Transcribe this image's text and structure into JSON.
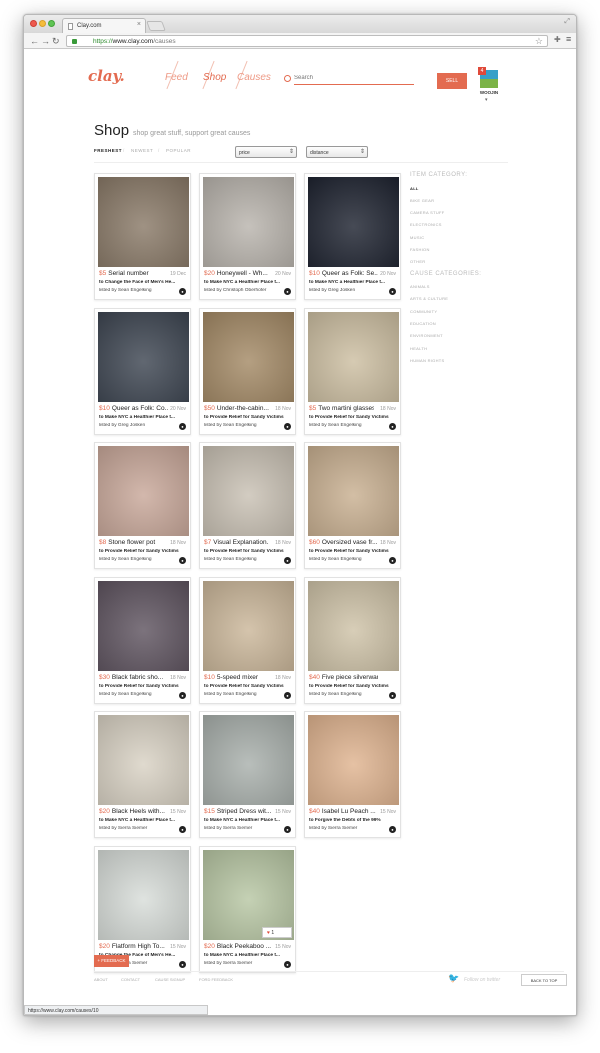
{
  "browser": {
    "tab_title": "Clay.com",
    "url_scheme": "https://",
    "url_host": "www.clay.com",
    "url_path": "/causes",
    "status_url": "https://www.clay.com/causes/10"
  },
  "header": {
    "logo": "clay.",
    "nav": [
      "Feed",
      "Shop",
      "Causes"
    ],
    "active_nav": "Shop",
    "search_placeholder": "Search",
    "sell_label": "SELL",
    "notification_count": "4",
    "user_name": "WOOJIN"
  },
  "shop": {
    "title": "Shop",
    "tagline": "shop great stuff, support great causes",
    "sort_options": [
      "FRESHEST",
      "NEWEST",
      "POPULAR"
    ],
    "filter_price": "price",
    "filter_distance": "distance"
  },
  "sidebar": {
    "item_heading": "ITEM CATEGORY:",
    "item_categories": [
      "ALL",
      "BIKE GEAR",
      "CAMERA STUFF",
      "ELECTRONICS",
      "MUSIC",
      "FASHION",
      "OTHER"
    ],
    "cause_heading": "CAUSE CATEGORIES:",
    "cause_categories": [
      "ANIMALS",
      "ARTS & CULTURE",
      "COMMUNITY",
      "EDUCATION",
      "ENVIRONMENT",
      "HEALTH",
      "HUMAN RIGHTS"
    ]
  },
  "listings": [
    {
      "price": "$5",
      "title": "Serial number",
      "date": "19 Dec",
      "cause": "to Change the Face of Men's He...",
      "lister": "listed by Sean Engelking",
      "thumb": "#8a7a68"
    },
    {
      "price": "$20",
      "title": "Honeywell - Wh...",
      "date": "20 Nov",
      "cause": "to Make NYC a Healthier Place t...",
      "lister": "listed by Christoph Oberhofer",
      "thumb": "#b9b4ad"
    },
    {
      "price": "$10",
      "title": "Queer as Folk: Se...",
      "date": "20 Nov",
      "cause": "to Make NYC a Healthier Place t...",
      "lister": "listed by Greg Josken",
      "thumb": "#1e2330"
    },
    {
      "price": "$10",
      "title": "Queer as Folk: Co...",
      "date": "20 Nov",
      "cause": "to Make NYC a Healthier Place t...",
      "lister": "listed by Greg Josken",
      "thumb": "#3e4652"
    },
    {
      "price": "$50",
      "title": "Under-the-cabin...",
      "date": "18 Nov",
      "cause": "to Provide Relief for Sandy Victims",
      "lister": "listed by Sean Engelking",
      "thumb": "#a48a66"
    },
    {
      "price": "$5",
      "title": "Two martini glasses",
      "date": "18 Nov",
      "cause": "to Provide Relief for Sandy Victims",
      "lister": "listed by Sean Engelking",
      "thumb": "#cdbfa2"
    },
    {
      "price": "$8",
      "title": "Stone flower pot",
      "date": "18 Nov",
      "cause": "to Provide Relief for Sandy Victims",
      "lister": "listed by Sean Engelking",
      "thumb": "#c9a89a"
    },
    {
      "price": "$7",
      "title": "Visual Explanation...",
      "date": "18 Nov",
      "cause": "to Provide Relief for Sandy Victims",
      "lister": "listed by Sean Engelking",
      "thumb": "#c9c1b4"
    },
    {
      "price": "$60",
      "title": "Oversized vase fr...",
      "date": "18 Nov",
      "cause": "to Provide Relief for Sandy Victims",
      "lister": "listed by Sean Engelking",
      "thumb": "#c9b091"
    },
    {
      "price": "$30",
      "title": "Black fabric sho...",
      "date": "18 Nov",
      "cause": "to Provide Relief for Sandy Victims",
      "lister": "listed by Sean Engelking",
      "thumb": "#5f5460"
    },
    {
      "price": "$10",
      "title": "5-speed mixer",
      "date": "18 Nov",
      "cause": "to Provide Relief for Sandy Victims",
      "lister": "listed by Sean Engelking",
      "thumb": "#cbb79a"
    },
    {
      "price": "$40",
      "title": "Five piece silverware set",
      "date": "",
      "cause": "to Provide Relief for Sandy Victims",
      "lister": "listed by Sean Engelking",
      "thumb": "#cfc3a8"
    },
    {
      "price": "$20",
      "title": "Black Heels with...",
      "date": "15 Nov",
      "cause": "to Make NYC a Healthier Place t...",
      "lister": "listed by Sierra Siemer",
      "thumb": "#d9d2c4"
    },
    {
      "price": "$15",
      "title": "Striped Dress wit...",
      "date": "15 Nov",
      "cause": "to Make NYC a Healthier Place t...",
      "lister": "listed by Sierra Siemer",
      "thumb": "#a9b0ac"
    },
    {
      "price": "$40",
      "title": "Isabel Lu Peach ...",
      "date": "15 Nov",
      "cause": "to Forgive the Debts of the 99%",
      "lister": "listed by Sierra Siemer",
      "thumb": "#e0b490"
    },
    {
      "price": "$20",
      "title": "Flatform High To...",
      "date": "15 Nov",
      "cause": "to Change the Face of Men's He...",
      "lister": "listed by Sierra Siemer",
      "thumb": "#d8ddd9"
    },
    {
      "price": "$20",
      "title": "Black Peekaboo ...",
      "date": "15 Nov",
      "cause": "to Make NYC a Healthier Place t...",
      "lister": "listed by Sierra Siemer",
      "thumb": "#b8c7a4",
      "likes": "1"
    }
  ],
  "footer": {
    "feedback_label": "+ FEEDBACK",
    "links": [
      "ABOUT",
      "CONTACT",
      "CAUSE SIGNUP",
      "FORD FEEDBACK"
    ],
    "twitter_text": "Follow on twitter",
    "back_to_top": "BACK TO TOP"
  },
  "colors": {
    "accent": "#e36b50"
  }
}
